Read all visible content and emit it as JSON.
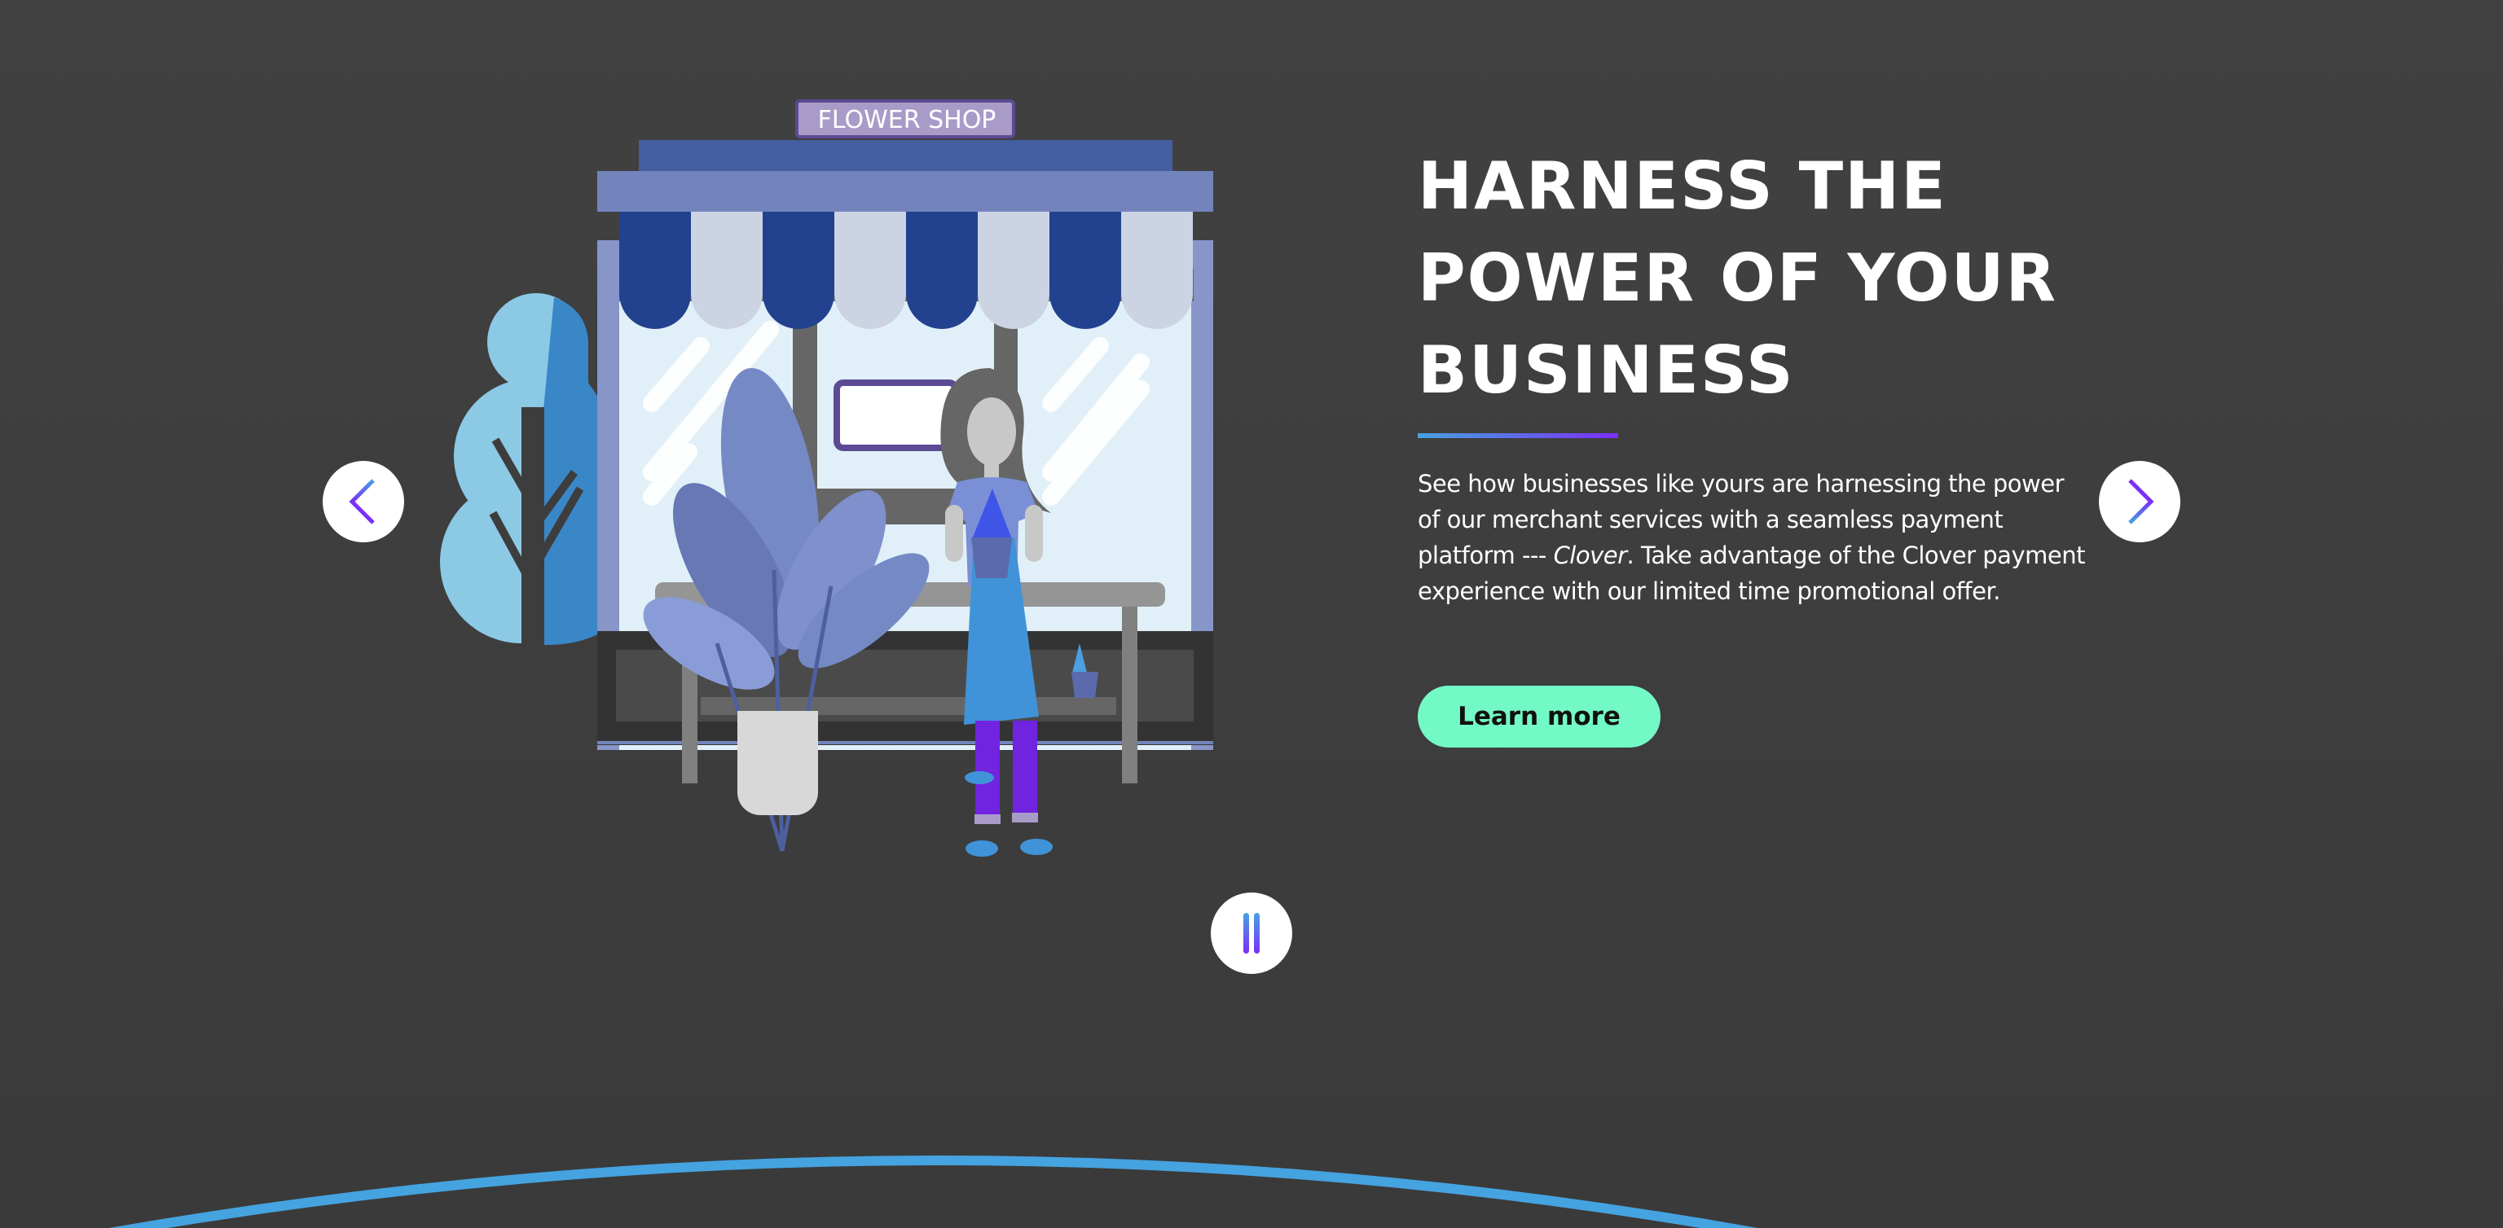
{
  "illustration": {
    "sign_text": "FLOWER SHOP"
  },
  "hero": {
    "title_lines": [
      "HARNESS THE",
      "POWER OF YOUR",
      "BUSINESS"
    ],
    "description_before": "See how businesses like yours are harnessing the power of our merchant services with a seamless payment platform --- ",
    "description_italic": "Clover",
    "description_after": ". Take advantage of the Clover payment experience with our limited time promotional offer.",
    "cta_label": "Learn more"
  },
  "carousel": {
    "prev_icon": "chevron-left-icon",
    "next_icon": "chevron-right-icon",
    "pause_icon": "pause-icon"
  },
  "colors": {
    "accent_start": "#45a3e0",
    "accent_end": "#7b2ff7",
    "cta": "#73f9c6",
    "background": "#404040"
  }
}
